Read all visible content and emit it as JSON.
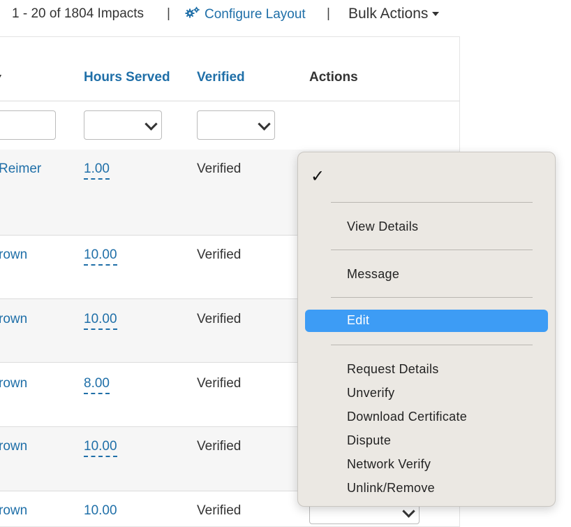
{
  "topbar": {
    "count_text": "1 - 20 of 1804 Impacts",
    "separator": "|",
    "configure_label": "Configure Layout",
    "bulk_label": "Bulk Actions",
    "accent": "#1f6fa8"
  },
  "table": {
    "headers": {
      "hours": "Hours Served",
      "verified": "Verified",
      "actions": "Actions"
    },
    "rows": [
      {
        "name": "Reimer",
        "hours": "1.00",
        "verified": "Verified"
      },
      {
        "name": "rown",
        "hours": "10.00",
        "verified": "Verified"
      },
      {
        "name": "rown",
        "hours": "10.00",
        "verified": "Verified"
      },
      {
        "name": "rown",
        "hours": "8.00",
        "verified": "Verified"
      },
      {
        "name": "rown",
        "hours": "10.00",
        "verified": "Verified"
      },
      {
        "name": "rown",
        "hours": "10.00",
        "verified": "Verified"
      }
    ]
  },
  "menu": {
    "check": "✓",
    "items": {
      "view_details": "View Details",
      "message": "Message",
      "edit": "Edit",
      "request_details": "Request Details",
      "unverify": "Unverify",
      "download_certificate": "Download Certificate",
      "dispute": "Dispute",
      "network_verify": "Network Verify",
      "unlink_remove": "Unlink/Remove"
    },
    "highlight_color": "#3d9cf5"
  }
}
